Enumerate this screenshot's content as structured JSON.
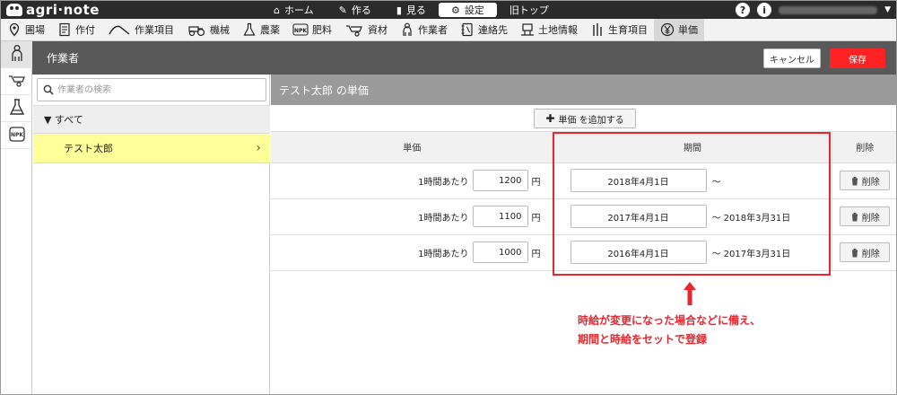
{
  "app": {
    "logo_text": "agri·note"
  },
  "topnav": {
    "items": [
      {
        "label": "ホーム",
        "icon": "home-icon",
        "glyph": "⌂"
      },
      {
        "label": "作る",
        "icon": "pencil-icon",
        "glyph": "✎"
      },
      {
        "label": "見る",
        "icon": "book-icon",
        "glyph": "▮"
      },
      {
        "label": "設定",
        "icon": "gear-icon",
        "glyph": "⚙"
      },
      {
        "label": "旧トップ",
        "icon": "",
        "glyph": ""
      }
    ],
    "active_index": 3,
    "help_glyph": "?",
    "feedback_glyph": "i",
    "user_caret": "▼"
  },
  "navbar": {
    "items": [
      {
        "label": "圃場",
        "icon": "map-pin-icon"
      },
      {
        "label": "作付",
        "icon": "document-icon"
      },
      {
        "label": "作業項目",
        "icon": "work-item-icon"
      },
      {
        "label": "機械",
        "icon": "tractor-icon"
      },
      {
        "label": "農薬",
        "icon": "flask-icon"
      },
      {
        "label": "肥料",
        "icon": "fertilizer-npk-icon",
        "badge": "NPK"
      },
      {
        "label": "資材",
        "icon": "wheelbarrow-icon"
      },
      {
        "label": "作業者",
        "icon": "worker-icon"
      },
      {
        "label": "連絡先",
        "icon": "contacts-icon"
      },
      {
        "label": "土地情報",
        "icon": "land-info-icon"
      },
      {
        "label": "生育項目",
        "icon": "growth-icon"
      },
      {
        "label": "単価",
        "icon": "yen-icon"
      }
    ],
    "active_index": 11
  },
  "rail": {
    "npk_badge": "NPK"
  },
  "header": {
    "title": "作業者",
    "cancel_label": "キャンセル",
    "save_label": "保存"
  },
  "leftpanel": {
    "search_placeholder": "作業者の検索",
    "tree_all_label": "▼ すべて",
    "selected_worker": "テスト太郎",
    "chevron": "›"
  },
  "main": {
    "title": "テスト太郎 の単価",
    "add_button_label": "単価 を追加する",
    "columns": {
      "rate": "単価",
      "period": "期間",
      "delete": "削除"
    },
    "rows": [
      {
        "rate_label": "1時間あたり",
        "rate_value": "1200",
        "unit": "円",
        "start_date": "2018年4月1日",
        "end_date": "〜",
        "delete_label": "削除"
      },
      {
        "rate_label": "1時間あたり",
        "rate_value": "1100",
        "unit": "円",
        "start_date": "2017年4月1日",
        "end_date": "〜 2018年3月31日",
        "delete_label": "削除"
      },
      {
        "rate_label": "1時間あたり",
        "rate_value": "1000",
        "unit": "円",
        "start_date": "2016年4月1日",
        "end_date": "〜 2017年3月31日",
        "delete_label": "削除"
      }
    ]
  },
  "annotation": {
    "line1": "時給が変更になった場合などに備え、",
    "line2": "期間と時給をセットで登録",
    "color": "#e8262e"
  }
}
